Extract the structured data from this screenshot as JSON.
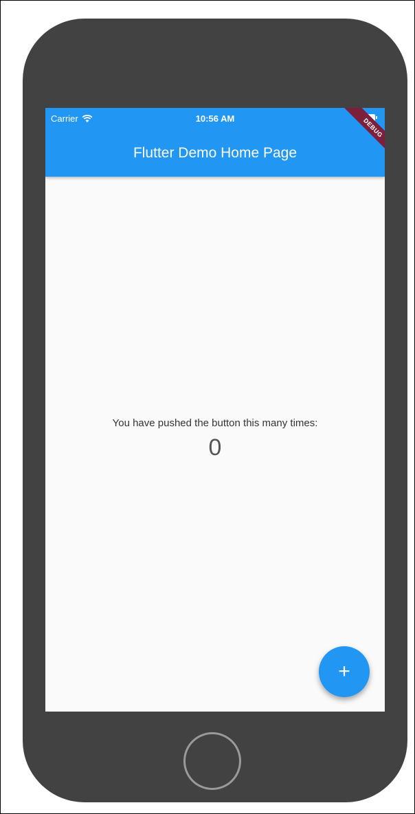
{
  "status_bar": {
    "carrier": "Carrier",
    "time": "10:56 AM",
    "wifi_icon": "wifi-icon",
    "battery_icon": "battery-icon"
  },
  "app_bar": {
    "title": "Flutter Demo Home Page",
    "color": "#2196f3"
  },
  "debug_banner": {
    "label": "DEBUG",
    "color": "#7b1f3a"
  },
  "body": {
    "message": "You have pushed the button this many times:",
    "counter": "0"
  },
  "fab": {
    "icon": "plus-icon",
    "label": "+"
  },
  "device": {
    "frame_color": "#424242",
    "home_button_icon": "home-button"
  }
}
